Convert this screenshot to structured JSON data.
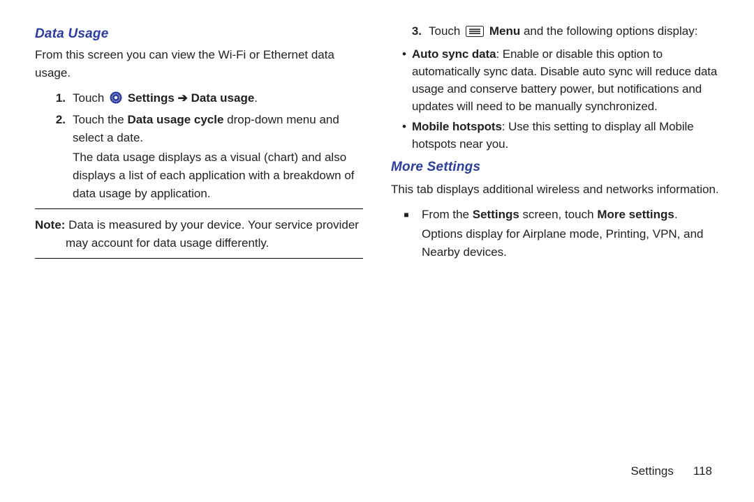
{
  "left": {
    "heading": "Data Usage",
    "intro": "From this screen you can view the Wi-Fi or Ethernet data usage.",
    "step1_num": "1.",
    "step1_pre": "Touch ",
    "step1_bold": " Settings ➔ Data usage",
    "step1_post": ".",
    "step2_num": "2.",
    "step2_a": "Touch the ",
    "step2_b": "Data usage cycle",
    "step2_c": " drop-down menu and select a date.",
    "step2_sub": "The data usage displays as a visual (chart) and also displays a list of each application with a breakdown of data usage by application.",
    "note_label": "Note:",
    "note_body": " Data is measured by your device. Your service provider may account for data usage differently."
  },
  "right": {
    "step3_num": "3.",
    "step3_pre": "Touch ",
    "step3_bold": " Menu",
    "step3_post": " and the following options display:",
    "b1_label": "Auto sync data",
    "b1_body": ": Enable or disable this option to automatically sync data. Disable auto sync will reduce data usage and conserve battery power, but notifications and updates will need to be manually synchronized.",
    "b2_label": "Mobile hotspots",
    "b2_body": ": Use this setting to display all Mobile hotspots near you.",
    "heading2": "More Settings",
    "intro2": "This tab displays additional wireless and networks information.",
    "sq": "■",
    "sq_a": "From the ",
    "sq_b": "Settings",
    "sq_c": " screen, touch ",
    "sq_d": "More settings",
    "sq_e": ".",
    "sq_sub": "Options display for Airplane mode, Printing, VPN, and Nearby devices."
  },
  "footer": {
    "section": "Settings",
    "page": "118"
  }
}
